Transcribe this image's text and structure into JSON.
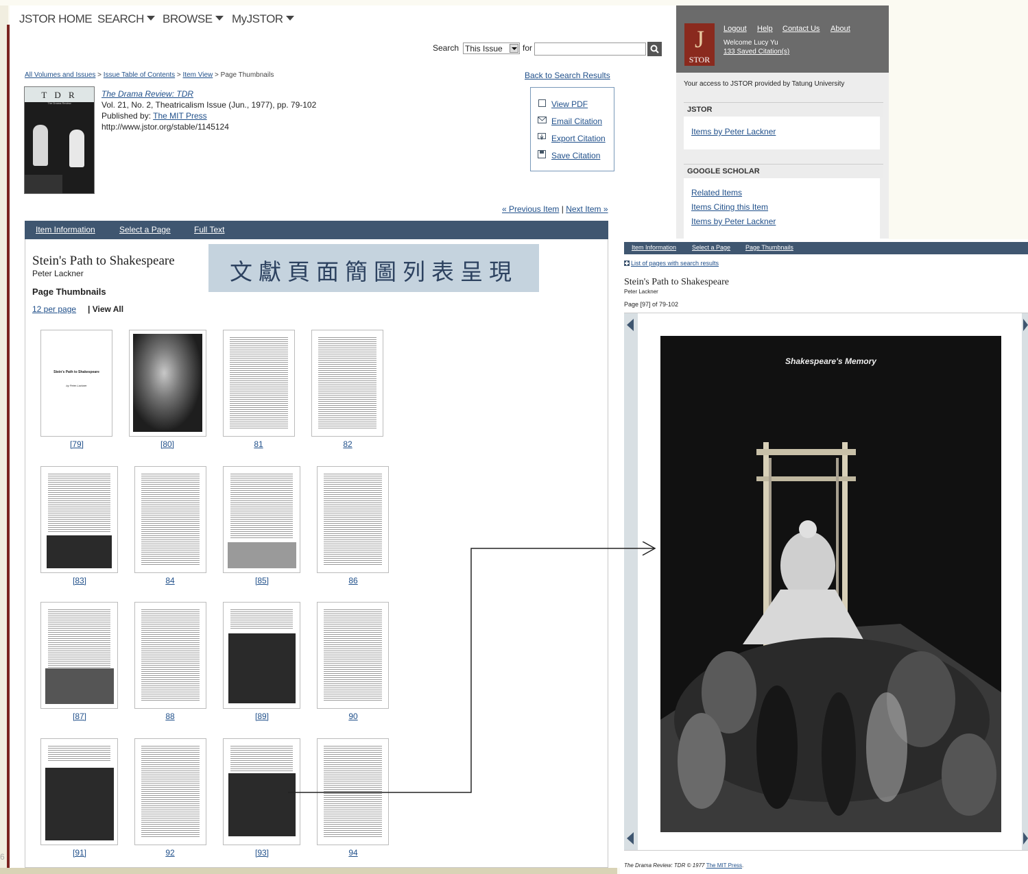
{
  "nav": {
    "home": "JSTOR HOME",
    "search": "SEARCH",
    "browse": "BROWSE",
    "myjstor": "MyJSTOR"
  },
  "search": {
    "label": "Search",
    "scope": "This Issue",
    "for_label": "for",
    "value": ""
  },
  "breadcrumb": {
    "all": "All Volumes and Issues",
    "sep": ">",
    "toc": "Issue Table of Contents",
    "item": "Item View",
    "current": "Page Thumbnails"
  },
  "back_link": "Back to Search Results",
  "journal": {
    "cover_title": "T D R",
    "cover_sub": "The Drama Review",
    "title": "The Drama Review: TDR",
    "volume": "Vol. 21, No. 2, Theatricalism Issue (Jun., 1977), pp. 79-102",
    "published_label": "Published by: ",
    "publisher": "The MIT Press",
    "url": "http://www.jstor.org/stable/1145124"
  },
  "actions": {
    "view_pdf": "View PDF",
    "email": "Email Citation",
    "export": "Export Citation",
    "save": "Save Citation"
  },
  "pager": {
    "prev": "« Previous Item",
    "sep": "|",
    "next": "Next Item »"
  },
  "tabs": {
    "info": "Item Information",
    "select": "Select a Page",
    "full": "Full Text"
  },
  "article": {
    "title": "Stein's Path to Shakespeare",
    "author": "Peter Lackner",
    "section": "Page Thumbnails",
    "per_page": "12 per page",
    "view_all": "| View All"
  },
  "caption": "文獻頁面簡圖列表呈現",
  "thumbs": {
    "first_title": "Stein's Path to Shakespeare",
    "first_by": "by Peter Lackner",
    "labels": [
      "[79]",
      "[80]",
      "81",
      "82",
      "[83]",
      "84",
      "[85]",
      "86",
      "[87]",
      "88",
      "[89]",
      "90",
      "[91]",
      "92",
      "[93]",
      "94"
    ]
  },
  "sidebar": {
    "links": {
      "logout": "Logout",
      "help": "Help",
      "contact": "Contact Us",
      "about": "About"
    },
    "welcome": "Welcome Lucy Yu",
    "saved": "133 Saved Citation(s)",
    "logo_letter": "J",
    "logo_text": "STOR",
    "access": "Your access to JSTOR provided by Tatung University",
    "jstor_head": "JSTOR",
    "jstor_item": "Items by Peter Lackner",
    "scholar_head": "GOOGLE SCHOLAR",
    "scholar_items": [
      "Related Items",
      "Items Citing this Item",
      "Items by Peter Lackner"
    ]
  },
  "viewer": {
    "tabs": {
      "info": "Item Information",
      "select": "Select a Page",
      "thumbs": "Page Thumbnails"
    },
    "list_link": "List of pages with search results",
    "title": "Stein's Path to Shakespeare",
    "author": "Peter Lackner",
    "page_info": "Page [97] of 79-102",
    "image_caption": "Shakespeare's Memory",
    "footer_pre": "The Drama Review: TDR © 1977 ",
    "footer_link": "The MIT Press",
    "footer_post": "."
  },
  "slide_number": "6",
  "colors": {
    "header_bar": "#3f5670",
    "brand_red": "#7a2420",
    "link": "#1f4f8a",
    "caption_bg": "#c5d3de"
  }
}
